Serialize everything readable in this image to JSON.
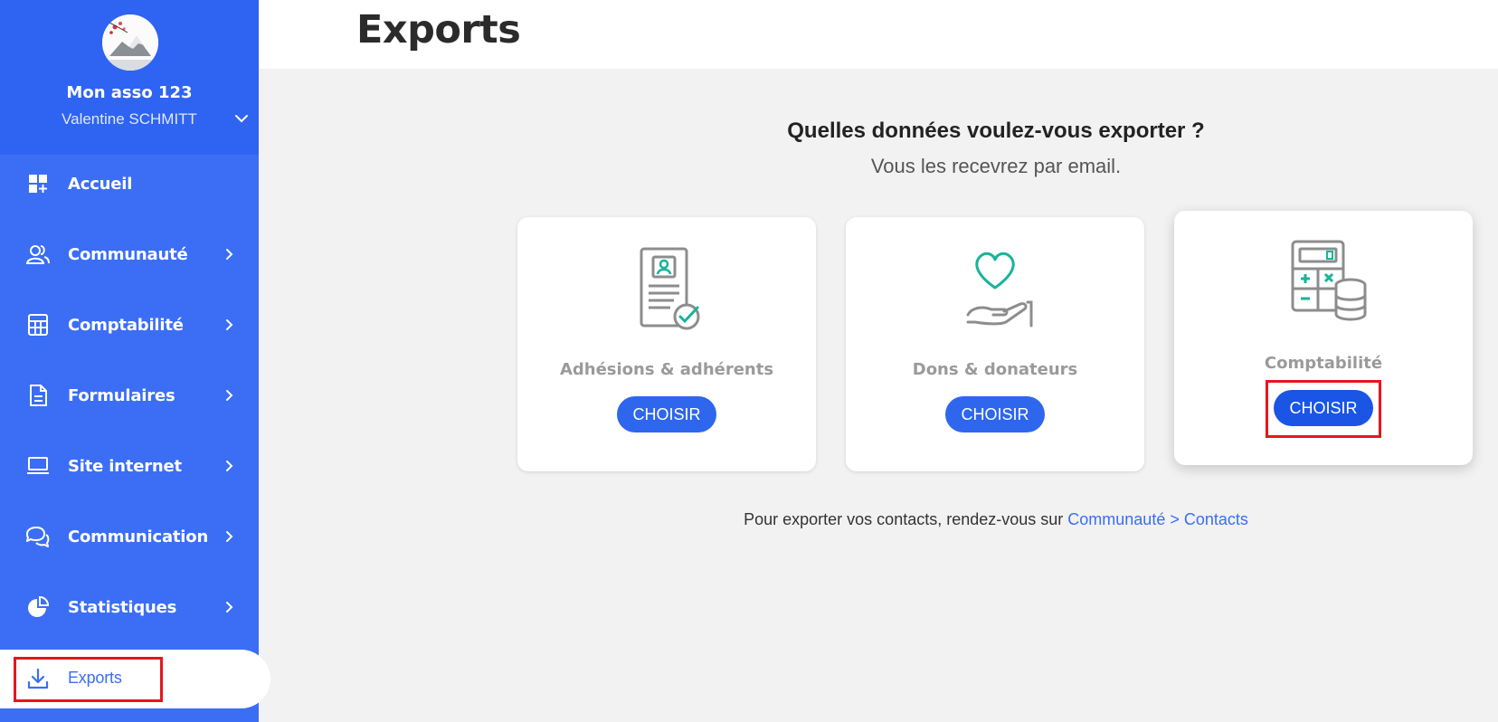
{
  "sidebar": {
    "org_name": "Mon asso 123",
    "user_name": "Valentine SCHMITT",
    "items": [
      {
        "label": "Accueil",
        "icon": "dashboard-icon"
      },
      {
        "label": "Communauté",
        "icon": "users-icon"
      },
      {
        "label": "Comptabilité",
        "icon": "calculator-icon"
      },
      {
        "label": "Formulaires",
        "icon": "document-icon"
      },
      {
        "label": "Site internet",
        "icon": "laptop-icon"
      },
      {
        "label": "Communication",
        "icon": "chat-icon"
      },
      {
        "label": "Statistiques",
        "icon": "pie-chart-icon"
      },
      {
        "label": "Exports",
        "icon": "download-icon",
        "active": true
      }
    ]
  },
  "header": {
    "title": "Exports"
  },
  "main": {
    "question": "Quelles données voulez-vous exporter ?",
    "subtitle": "Vous les recevrez par email.",
    "cards": [
      {
        "label": "Adhésions & adhérents",
        "button": "CHOISIR",
        "icon": "membership-card-icon"
      },
      {
        "label": "Dons & donateurs",
        "button": "CHOISIR",
        "icon": "heart-hand-icon"
      },
      {
        "label": "Comptabilité",
        "button": "CHOISIR",
        "icon": "calculator-coins-icon"
      }
    ],
    "footer_text": "Pour exporter vos contacts, rendez-vous sur ",
    "footer_link": "Communauté > Contacts"
  },
  "colors": {
    "sidebar_bg": "#3b6ef5",
    "sidebar_head_bg": "#2f63f2",
    "button_bg": "#2e66ee",
    "highlight": "#e8141e",
    "accent_green": "#19b39b"
  }
}
